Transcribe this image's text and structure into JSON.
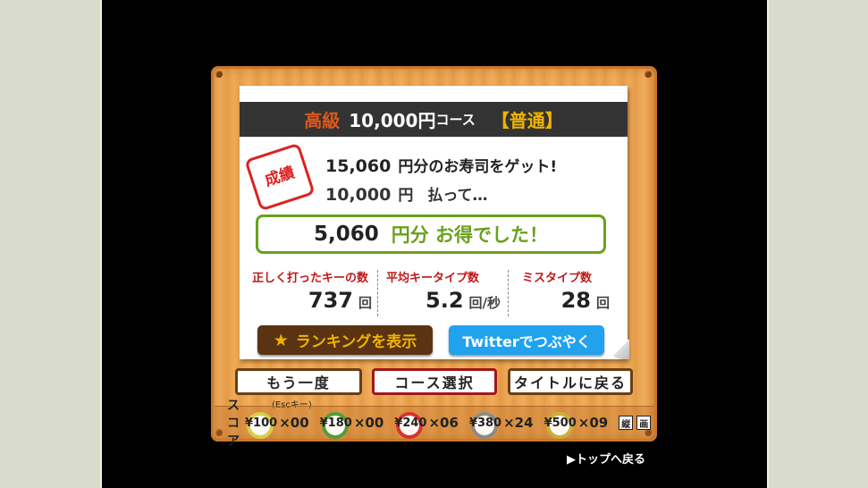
{
  "header": {
    "grade": "高級",
    "price": "10,000円",
    "course": "コース",
    "difficulty": "【普通】"
  },
  "result": {
    "stamp": "成績",
    "got_amount": "15,060",
    "got_text": "円分のお寿司をゲット!",
    "paid_amount": "10,000",
    "paid_unit": "円",
    "paid_text": "払って…",
    "gain_amount": "5,060",
    "gain_text": "円分 お得でした！"
  },
  "stats": [
    {
      "label": "正しく打ったキーの数",
      "value": "737",
      "unit": "回"
    },
    {
      "label": "平均キータイプ数",
      "value": "5.2",
      "unit": "回/秒"
    },
    {
      "label": "ミスタイプ数",
      "value": "28",
      "unit": "回"
    }
  ],
  "buttons": {
    "ranking": "ランキングを表示",
    "twitter": "Twitterでつぶやく",
    "retry": "もう一度",
    "retry_hint": "(Escキー)",
    "course_select": "コース選択",
    "back_title": "タイトルに戻る"
  },
  "score": {
    "label": "スコア",
    "plates": [
      {
        "price": "¥100",
        "count": "×00",
        "color": "#d8d24a"
      },
      {
        "price": "¥180",
        "count": "×00",
        "color": "#4aa03a"
      },
      {
        "price": "¥240",
        "count": "×06",
        "color": "#d83030"
      },
      {
        "price": "¥380",
        "count": "×24",
        "color": "#8a8a8a"
      },
      {
        "price": "¥500",
        "count": "×09",
        "color": "#c8b43a"
      }
    ],
    "icons": [
      "縦",
      "画"
    ]
  },
  "footer": {
    "top_link": "▶トップへ戻る"
  }
}
